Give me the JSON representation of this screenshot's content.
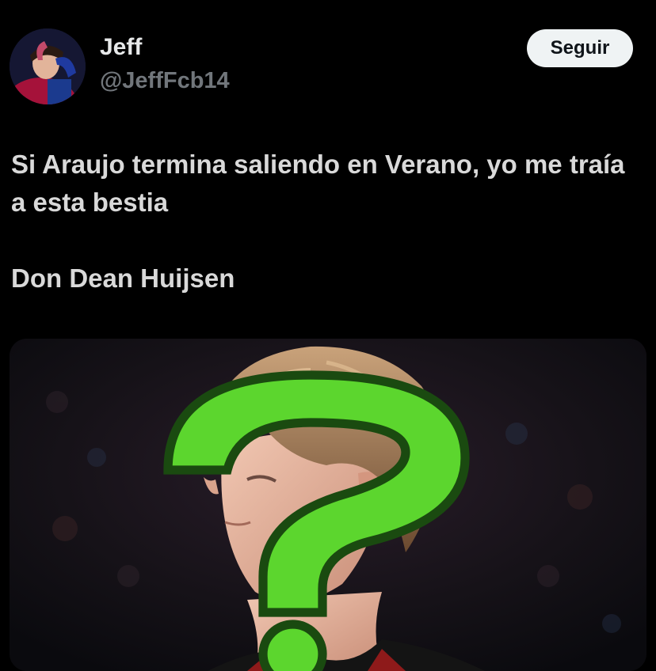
{
  "author": {
    "display_name": "Jeff",
    "handle": "@JeffFcb14"
  },
  "follow_button": {
    "label": "Seguir"
  },
  "tweet": {
    "paragraphs": [
      "Si Araujo termina saliendo en Verano, yo me traía a esta bestia",
      "Don Dean Huijsen"
    ]
  },
  "icons": {
    "avatar": "profile-avatar",
    "media_overlay": "question-mark-icon"
  },
  "colors": {
    "background": "#000000",
    "text_primary": "#e7e9ea",
    "text_secondary": "#71767b",
    "button_bg": "#eff3f4",
    "question_mark": "#5cd62e"
  }
}
